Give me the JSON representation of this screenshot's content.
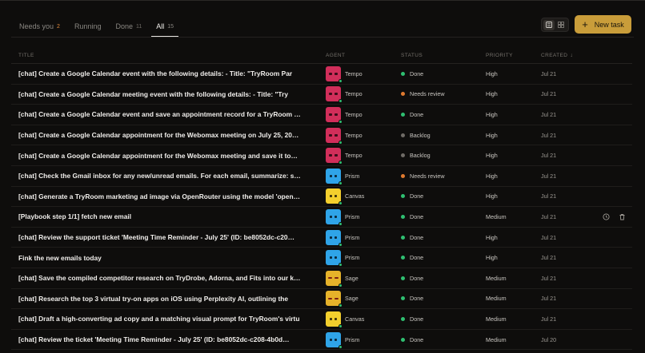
{
  "tabs": [
    {
      "label": "Needs you",
      "count": "2",
      "warn": true
    },
    {
      "label": "Running",
      "count": ""
    },
    {
      "label": "Done",
      "count": "11"
    },
    {
      "label": "All",
      "count": "15",
      "active": true
    }
  ],
  "toolbar": {
    "new_task_label": "New task",
    "list_view_icon": "list-icon",
    "grid_view_icon": "grid-icon"
  },
  "columns": {
    "title": "TITLE",
    "agent": "AGENT",
    "status": "STATUS",
    "priority": "PRIORITY",
    "created": "CREATED"
  },
  "status_colors": {
    "Done": "#2fbf71",
    "Needs review": "#e07a2f",
    "Backlog": "#6f6b66"
  },
  "rows": [
    {
      "title": "[chat] Create a Google Calendar event with the following details: - Title: \"TryRoom Par",
      "agent": "Tempo",
      "agent_kind": "tempo",
      "status": "Done",
      "priority": "High",
      "created": "Jul 21"
    },
    {
      "title": "[chat] Create a Google Calendar meeting event with the following details: - Title: \"Try",
      "agent": "Tempo",
      "agent_kind": "tempo",
      "status": "Needs review",
      "priority": "High",
      "created": "Jul 21"
    },
    {
      "title": "[chat] Create a Google Calendar event and save an appointment record for a TryRoom …",
      "agent": "Tempo",
      "agent_kind": "tempo",
      "status": "Done",
      "priority": "High",
      "created": "Jul 21"
    },
    {
      "title": "[chat] Create a Google Calendar appointment for the Webomax meeting on July 25, 20…",
      "agent": "Tempo",
      "agent_kind": "tempo",
      "status": "Backlog",
      "priority": "High",
      "created": "Jul 21"
    },
    {
      "title": "[chat] Create a Google Calendar appointment for the Webomax meeting and save it to…",
      "agent": "Tempo",
      "agent_kind": "tempo",
      "status": "Backlog",
      "priority": "High",
      "created": "Jul 21"
    },
    {
      "title": "[chat] Check the Gmail inbox for any new/unread emails. For each email, summarize: s…",
      "agent": "Prism",
      "agent_kind": "prism",
      "status": "Needs review",
      "priority": "High",
      "created": "Jul 21"
    },
    {
      "title": "[chat] Generate a TryRoom marketing ad image via OpenRouter using the model 'open…",
      "agent": "Canvas",
      "agent_kind": "canvas",
      "status": "Done",
      "priority": "High",
      "created": "Jul 21"
    },
    {
      "title": "[Playbook step 1/1] fetch new email",
      "agent": "Prism",
      "agent_kind": "prism",
      "status": "Done",
      "priority": "Medium",
      "created": "Jul 21",
      "actions": true
    },
    {
      "title": "[chat] Review the support ticket 'Meeting Time Reminder - July 25' (ID: be8052dc-c20…",
      "agent": "Prism",
      "agent_kind": "prism",
      "status": "Done",
      "priority": "High",
      "created": "Jul 21"
    },
    {
      "title": "Fink the new emails today",
      "agent": "Prism",
      "agent_kind": "prism",
      "status": "Done",
      "priority": "High",
      "created": "Jul 21"
    },
    {
      "title": "[chat] Save the compiled competitor research on TryDrobe, Adorna, and Fits into our k…",
      "agent": "Sage",
      "agent_kind": "sage",
      "status": "Done",
      "priority": "Medium",
      "created": "Jul 21"
    },
    {
      "title": "[chat] Research the top 3 virtual try-on apps on iOS using Perplexity AI, outlining the",
      "agent": "Sage",
      "agent_kind": "sage",
      "status": "Done",
      "priority": "Medium",
      "created": "Jul 21"
    },
    {
      "title": "[chat] Draft a high-converting ad copy and a matching visual prompt for TryRoom's virtu",
      "agent": "Canvas",
      "agent_kind": "canvas",
      "status": "Done",
      "priority": "Medium",
      "created": "Jul 21"
    },
    {
      "title": "[chat] Review the ticket 'Meeting Time Reminder - July 25' (ID: be8052dc-c208-4b0d…",
      "agent": "Prism",
      "agent_kind": "prism",
      "status": "Done",
      "priority": "Medium",
      "created": "Jul 20"
    }
  ]
}
